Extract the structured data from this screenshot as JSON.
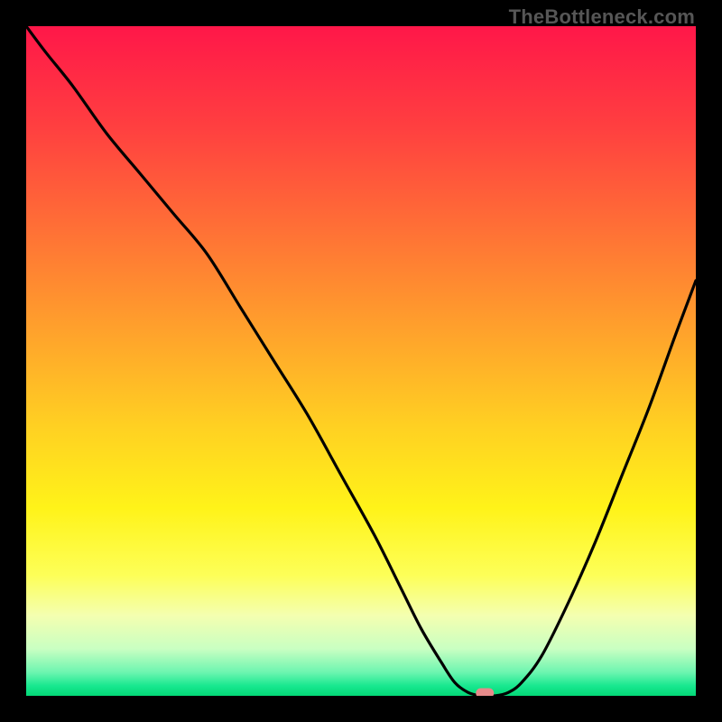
{
  "watermark": "TheBottleneck.com",
  "chart_data": {
    "type": "line",
    "title": "",
    "xlabel": "",
    "ylabel": "",
    "xlim": [
      0,
      100
    ],
    "ylim": [
      0,
      100
    ],
    "grid": false,
    "series": [
      {
        "name": "bottleneck-curve",
        "x": [
          0,
          3,
          7,
          12,
          17,
          22,
          27,
          32,
          37,
          42,
          47,
          52,
          56,
          59,
          62,
          64,
          66,
          68,
          70,
          72,
          74,
          77,
          81,
          85,
          89,
          93,
          97,
          100
        ],
        "y": [
          100,
          96,
          91,
          84,
          78,
          72,
          66,
          58,
          50,
          42,
          33,
          24,
          16,
          10,
          5,
          2,
          0.5,
          0,
          0,
          0.5,
          2,
          6,
          14,
          23,
          33,
          43,
          54,
          62
        ]
      }
    ],
    "markers": [
      {
        "name": "optimal-point",
        "x": 68.5,
        "y": 0.4,
        "color": "#e68a8a"
      }
    ],
    "background_gradient": {
      "type": "vertical",
      "stops": [
        {
          "pos": 0.0,
          "color": "#ff1749"
        },
        {
          "pos": 0.15,
          "color": "#ff3f40"
        },
        {
          "pos": 0.3,
          "color": "#ff6f36"
        },
        {
          "pos": 0.45,
          "color": "#ffa02c"
        },
        {
          "pos": 0.6,
          "color": "#ffd122"
        },
        {
          "pos": 0.72,
          "color": "#fff319"
        },
        {
          "pos": 0.82,
          "color": "#fdff58"
        },
        {
          "pos": 0.88,
          "color": "#f4ffb0"
        },
        {
          "pos": 0.93,
          "color": "#c9ffc2"
        },
        {
          "pos": 0.965,
          "color": "#6cf5b0"
        },
        {
          "pos": 0.985,
          "color": "#18e88f"
        },
        {
          "pos": 1.0,
          "color": "#03d877"
        }
      ]
    }
  }
}
